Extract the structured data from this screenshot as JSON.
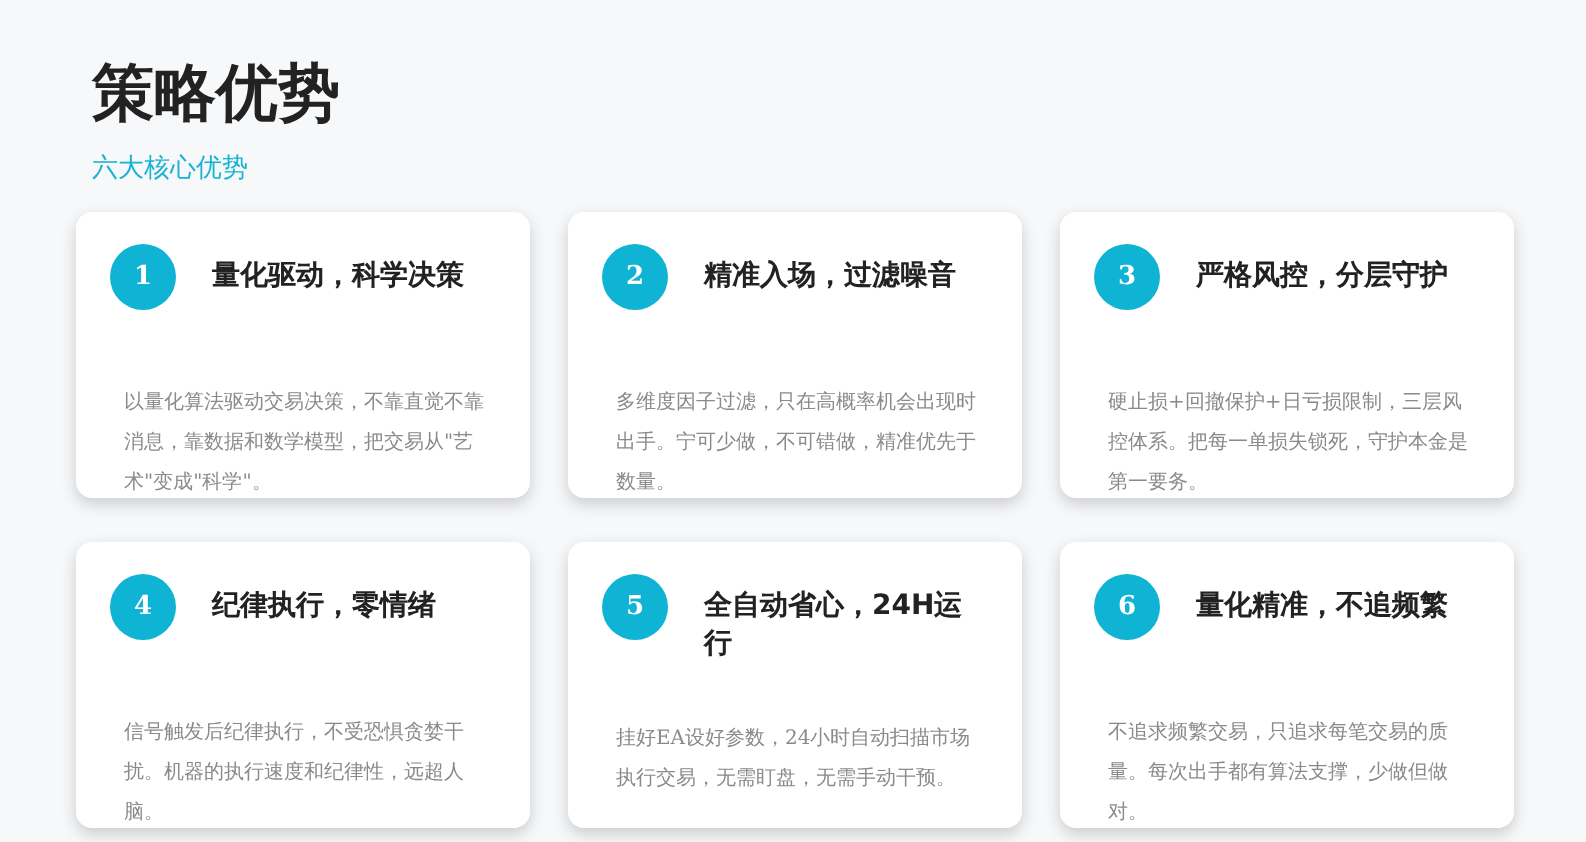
{
  "header": {
    "title": "策略优势",
    "subtitle": "六大核心优势"
  },
  "cards": [
    {
      "number": "1",
      "title": "量化驱动，科学决策",
      "description": "以量化算法驱动交易决策，不靠直觉不靠消息，靠数据和数学模型，把交易从\"艺术\"变成\"科学\"。"
    },
    {
      "number": "2",
      "title": "精准入场，过滤噪音",
      "description": "多维度因子过滤，只在高概率机会出现时出手。宁可少做，不可错做，精准优先于数量。"
    },
    {
      "number": "3",
      "title": "严格风控，分层守护",
      "description": "硬止损+回撤保护+日亏损限制，三层风控体系。把每一单损失锁死，守护本金是第一要务。"
    },
    {
      "number": "4",
      "title": "纪律执行，零情绪",
      "description": "信号触发后纪律执行，不受恐惧贪婪干扰。机器的执行速度和纪律性，远超人脑。"
    },
    {
      "number": "5",
      "title": "全自动省心，24H运行",
      "description": "挂好EA设好参数，24小时自动扫描市场执行交易，无需盯盘，无需手动干预。"
    },
    {
      "number": "6",
      "title": "量化精准，不追频繁",
      "description": "不追求频繁交易，只追求每笔交易的质量。每次出手都有算法支撑，少做但做对。"
    }
  ]
}
